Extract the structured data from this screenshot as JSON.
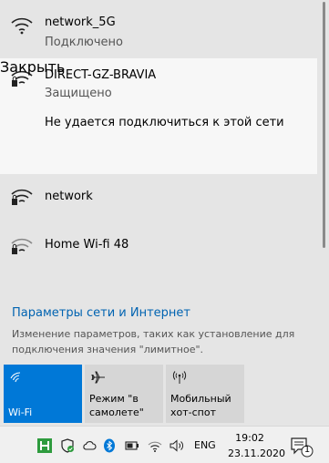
{
  "networks": [
    {
      "name": "network_5G",
      "status": "Подключено",
      "icon": "wifi-signal-icon"
    },
    {
      "name": "DIRECT-GZ-BRAVIA",
      "status": "Защищено",
      "error": "Не удается подключиться к этой сети",
      "close_label": "Закрыть",
      "icon": "wifi-secured-icon"
    },
    {
      "name": "network",
      "icon": "wifi-secured-icon"
    },
    {
      "name": "Home Wi-fi 48",
      "icon": "wifi-secured-icon"
    }
  ],
  "settings": {
    "link": "Параметры сети и Интернет",
    "description": "Изменение параметров, таких как установление для подключения значения \"лимитное\"."
  },
  "quick_actions": [
    {
      "label": "Wi-Fi",
      "icon": "wifi-icon",
      "active": true
    },
    {
      "label": "Режим \"в самолете\"",
      "label_line1": "Режим \"в",
      "label_line2": "самолете\"",
      "icon": "airplane-icon",
      "active": false
    },
    {
      "label": "Мобильный хот-спот",
      "label_line1": "Мобильный",
      "label_line2": "хот-спот",
      "icon": "hotspot-icon",
      "active": false
    }
  ],
  "taskbar": {
    "language": "ENG",
    "time": "19:02",
    "date": "23.11.2020",
    "notification_count": "1"
  },
  "colors": {
    "accent": "#0078d7",
    "link": "#0063b1",
    "flyout_bg": "#e5e5e5",
    "selected_bg": "#f7f7f7"
  }
}
